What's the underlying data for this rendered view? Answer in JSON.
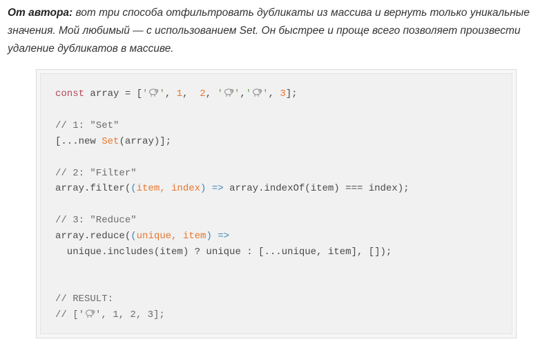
{
  "intro": {
    "lead": "От автора:",
    "text": " вот три способа отфильтровать дубликаты из массива и вернуть только уникальные значения. Мой любимый — с использованием Set. Он быстрее и проще всего позволяет произвести удаление дубликатов в массиве."
  },
  "code": {
    "line1": {
      "kw": "const",
      "a": " array = [",
      "q1": "'",
      "q2": "'",
      "b": ", ",
      "n1": "1",
      "c": ",  ",
      "n2": "2",
      "d": ", ",
      "q3": "'",
      "q4": "'",
      "e": ",",
      "q5": "'",
      "q6": "'",
      "f": ", ",
      "n3": "3",
      "g": "];"
    },
    "line2": "// 1: \"Set\"",
    "line3": {
      "a": "[...new ",
      "fn": "Set",
      "b": "(array)];"
    },
    "line4": "// 2: \"Filter\"",
    "line5": {
      "a": "array.filter(",
      "p1": "(",
      "args": "item, index",
      "p2": ")",
      "arrow": " =>",
      "b": " array.indexOf(item) === index);"
    },
    "line6": "// 3: \"Reduce\"",
    "line7": {
      "a": "array.reduce(",
      "p1": "(",
      "args": "unique, item",
      "p2": ")",
      "arrow": " =>"
    },
    "line8": "  unique.includes(item) ? unique : [...unique, item], []);",
    "line9": "// RESULT:",
    "line10": {
      "a": "// [",
      "q1": "'",
      "q2": "'",
      "b": ", 1, 2, 3];"
    }
  },
  "icons": {
    "sheep": "sheep-icon"
  },
  "colors": {
    "keyword": "#b3485a",
    "function": "#e8772e",
    "arrow": "#3b86b5",
    "comment": "#6c6c6c"
  }
}
